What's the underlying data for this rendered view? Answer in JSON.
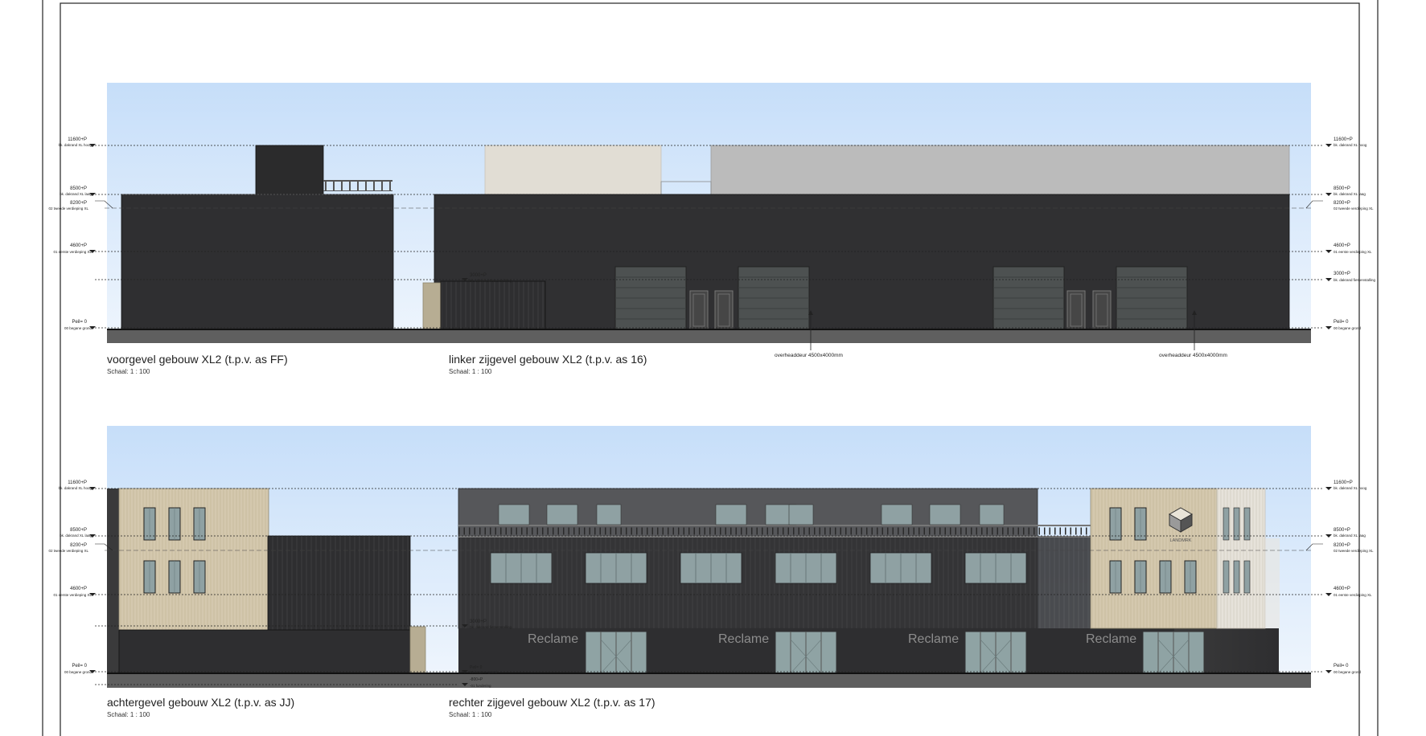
{
  "sections": [
    {
      "title": "voorgevel gebouw XL2 (t.p.v. as FF)",
      "scale": "Schaal:  1 : 100"
    },
    {
      "title": "linker zijgevel gebouw XL2 (t.p.v. as 16)",
      "scale": "Schaal:  1 : 100"
    },
    {
      "title": "achtergevel gebouw XL2 (t.p.v. as JJ)",
      "scale": "Schaal:  1 : 100"
    },
    {
      "title": "rechter zijgevel gebouw XL2 (t.p.v. as 17)",
      "scale": "Schaal:  1 : 100"
    }
  ],
  "door_annotation": "overheaddeur 4500x4000mm",
  "signage": "Reclame",
  "logo_text": "LANDMRK",
  "levels": {
    "top": {
      "value": "11600+P",
      "name": "bk. dakrand XL hoog"
    },
    "roof": {
      "value": "8500+P",
      "name": "bk. dakrand XL laag"
    },
    "floor2": {
      "value": "8200+P",
      "name": "02 tweede verdieping XL"
    },
    "floor1": {
      "value": "4600+P",
      "name": "01 eerste verdieping XL"
    },
    "canopy": {
      "value": "3000+P",
      "name": "bk. dakrand fietsenstalling"
    },
    "ground": {
      "value": "Peil= 0",
      "name": "00 begane grond"
    },
    "foundation": {
      "value": "-800+P",
      "name": "-01 fundering"
    }
  },
  "colors": {
    "sky_top": "#c9e0fb",
    "sky_bottom": "#e8f2fd",
    "facade_dark": "#2f2f30",
    "upper_grey": "#bdbdbd",
    "cladding_light": "#d8ccb2",
    "glass": "#8fa3a4",
    "ground": "#5f5f5f"
  }
}
